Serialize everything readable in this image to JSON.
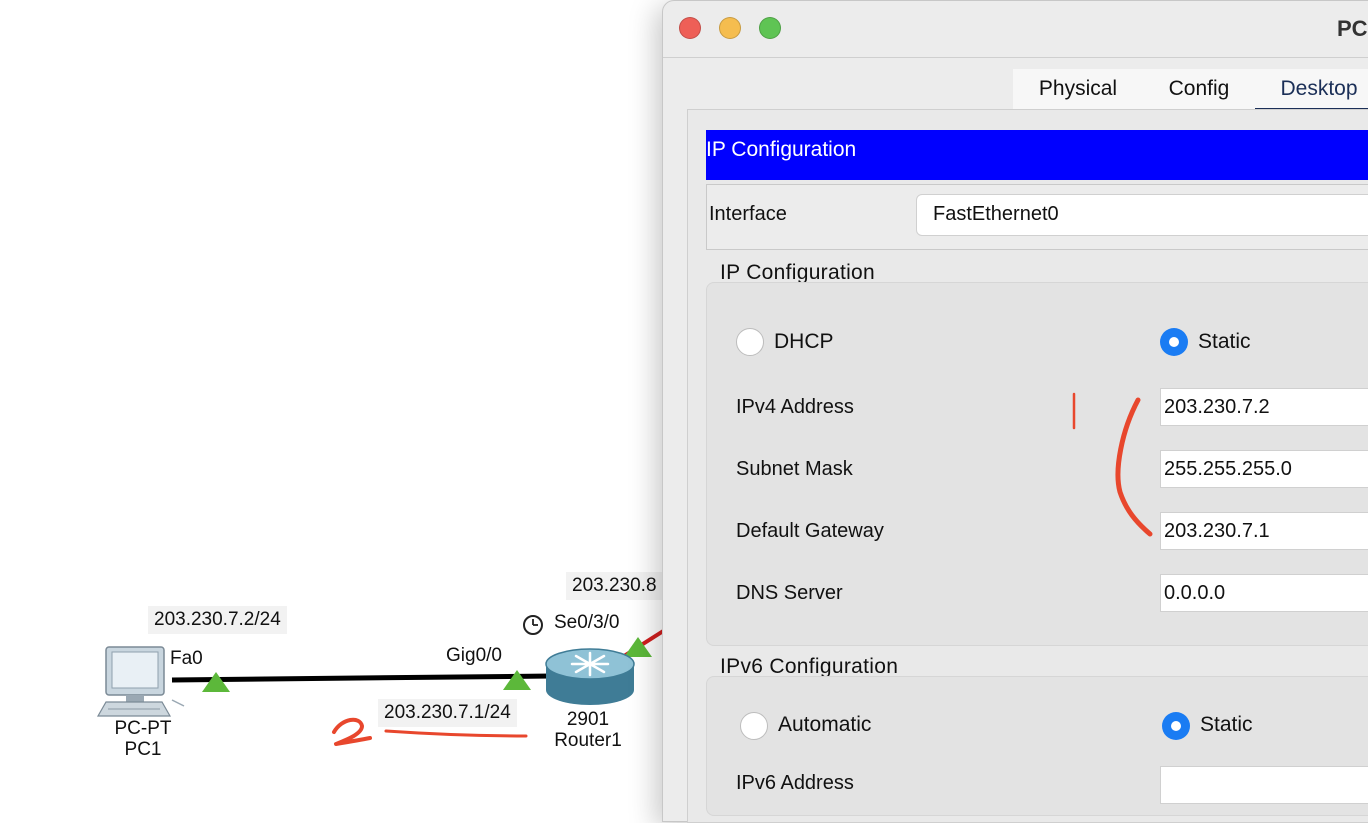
{
  "topology": {
    "pc": {
      "type": "PC-PT",
      "name": "PC1",
      "port": "Fa0",
      "ip": "203.230.7.2/24"
    },
    "router": {
      "model": "2901",
      "name": "Router1",
      "gig_port": "Gig0/0",
      "gig_ip": "203.230.7.1/24",
      "serial_port": "Se0/3/0",
      "serial_ip_partial": "203.230.8"
    },
    "annotation_number": "2"
  },
  "window": {
    "title": "PC",
    "tabs": [
      "Physical",
      "Config",
      "Desktop"
    ],
    "active_tab": "Desktop",
    "panel_title": "IP Configuration",
    "interface_label": "Interface",
    "interface_value": "FastEthernet0",
    "ipv4_section": {
      "title": "IP Configuration",
      "dhcp_label": "DHCP",
      "static_label": "Static",
      "selected": "Static",
      "fields": [
        {
          "label": "IPv4 Address",
          "value": "203.230.7.2"
        },
        {
          "label": "Subnet Mask",
          "value": "255.255.255.0"
        },
        {
          "label": "Default Gateway",
          "value": "203.230.7.1"
        },
        {
          "label": "DNS Server",
          "value": "0.0.0.0"
        }
      ]
    },
    "ipv6_section": {
      "title": "IPv6 Configuration",
      "auto_label": "Automatic",
      "static_label": "Static",
      "selected": "Static",
      "address_label": "IPv6 Address",
      "address_value": ""
    }
  },
  "colors": {
    "blue_bar": "#0000ff",
    "radio_selected": "#1a7cf3",
    "link_up": "#5cb83a",
    "annotation_red": "#e8472d",
    "serial_link": "#d21f1f"
  }
}
